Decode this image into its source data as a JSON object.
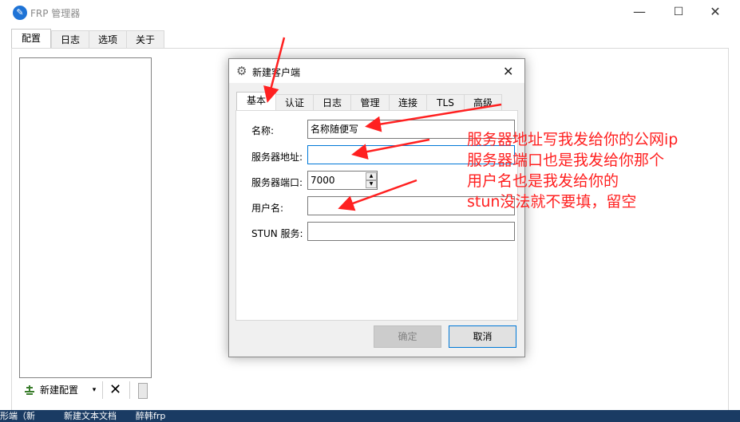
{
  "window": {
    "title": "FRP 管理器",
    "controls": {
      "minimize": "—",
      "maximize": "☐",
      "close": "✕"
    }
  },
  "main_tabs": [
    {
      "label": "配置",
      "active": true
    },
    {
      "label": "日志",
      "active": false
    },
    {
      "label": "选项",
      "active": false
    },
    {
      "label": "关于",
      "active": false
    }
  ],
  "toolbar": {
    "new_config_label": "新建配置",
    "dropdown_glyph": "▾",
    "delete_glyph": "✕"
  },
  "taskbar_fragments": [
    "形端（新",
    "新建文本文档",
    "醉韩frp"
  ],
  "dialog": {
    "title": "新建客户端",
    "close_glyph": "✕",
    "tabs": [
      {
        "label": "基本",
        "active": true
      },
      {
        "label": "认证",
        "active": false
      },
      {
        "label": "日志",
        "active": false
      },
      {
        "label": "管理",
        "active": false
      },
      {
        "label": "连接",
        "active": false
      },
      {
        "label": "TLS",
        "active": false
      },
      {
        "label": "高级",
        "active": false
      }
    ],
    "fields": {
      "name": {
        "label": "名称:",
        "value": "名称随便写"
      },
      "server_addr": {
        "label": "服务器地址:",
        "value": ""
      },
      "server_port": {
        "label": "服务器端口:",
        "value": "7000"
      },
      "user": {
        "label": "用户名:",
        "value": ""
      },
      "stun": {
        "label": "STUN 服务:",
        "value": ""
      }
    },
    "buttons": {
      "ok": "确定",
      "cancel": "取消"
    }
  },
  "annotation": {
    "lines": [
      "服务器地址写我发给你的公网ip",
      "服务器端口也是我发给你那个",
      "用户名也是我发给你的",
      "stun没法就不要填，留空"
    ],
    "color": "#ff2020"
  }
}
